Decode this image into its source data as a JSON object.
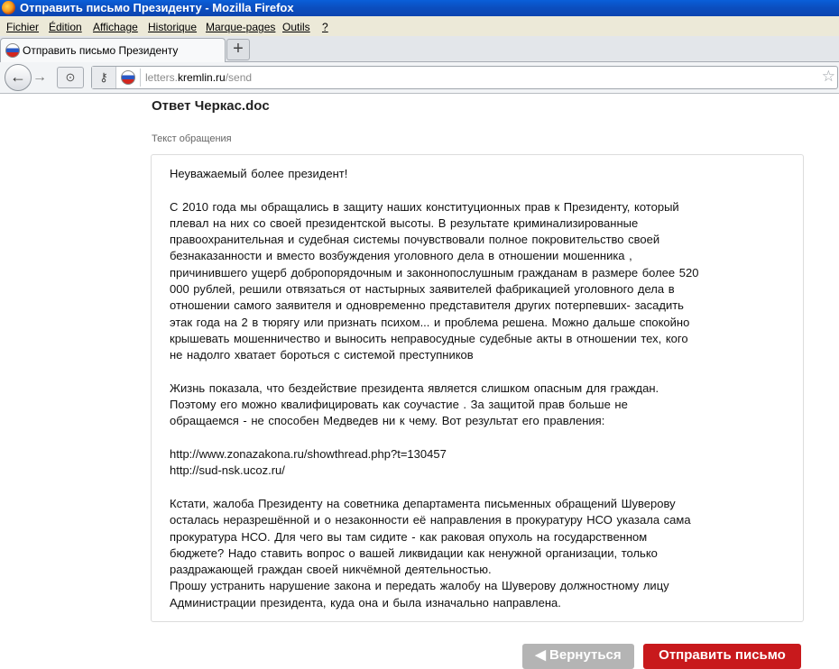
{
  "window": {
    "title": "Отправить письмо Президенту - Mozilla Firefox"
  },
  "menu": {
    "items": [
      "Fichier",
      "Édition",
      "Affichage",
      "Historique",
      "Marque-pages",
      "Outils",
      "?"
    ]
  },
  "tabs": [
    {
      "label": "Отправить письмо Президенту",
      "icon": "russia-flag-icon"
    }
  ],
  "new_tab_symbol": "+",
  "navbar": {
    "back_symbol": "←",
    "forward_symbol": "→",
    "url_prefix": "letters.",
    "url_host": "kremlin.ru",
    "url_path": "/send"
  },
  "page": {
    "document_title": "Ответ Черкас.doc",
    "field_label": "Текст обращения",
    "message": "Неуважаемый более президент!\n\nС 2010 года мы обращались в защиту наших конституционных прав к Президенту, который\nплевал на них со своей президентской высоты. В результате криминализированные\nправоохранительная и судебная системы почувствовали полное покровительство своей\nбезнаказанности и вместо возбуждения уголовного дела в отношении мошенника ,\nпричинившего ущерб добропорядочным и законнопослушным гражданам в размере более 520\n000 рублей, решили отвязаться от настырных заявителей фабрикацией уголовного дела в\nотношении самого заявителя и одновременно представителя других потерпевших- засадить\nэтак года на 2 в тюрягу или признать психом... и проблема решена. Можно дальше спокойно\nкрышевать мошенничество и выносить неправосудные судебные акты в отношении тех, кого\nне надолго хватает бороться с системой преступников\n\nЖизнь показала, что бездействие президента является слишком опасным для граждан.\nПоэтому его можно квалифицировать как соучастие . За защитой прав больше не\nобращаемся - не способен Медведев ни к чему. Вот результат его правления:\n\nhttp://www.zonazakona.ru/showthread.php?t=130457\nhttp://sud-nsk.ucoz.ru/\n\nКстати, жалоба Президенту на советника департамента письменных обращений Шуверову\nосталась неразрешённой и о незаконности её направления в прокуратуру НСО указала сама\nпрокуратура НСО. Для чего вы там сидите - как раковая опухоль на государственном\nбюджете? Надо ставить вопрос о вашей ликвидации как ненужной организации, только\nраздражающей граждан своей никчёмной деятельностью.\nПрошу устранить нарушение закона и передать жалобу на Шуверову должностному лицу\nАдминистрации президента, куда она и была изначально направлена.",
    "back_button": "◀ Вернуться",
    "send_button": "Отправить письмо"
  }
}
